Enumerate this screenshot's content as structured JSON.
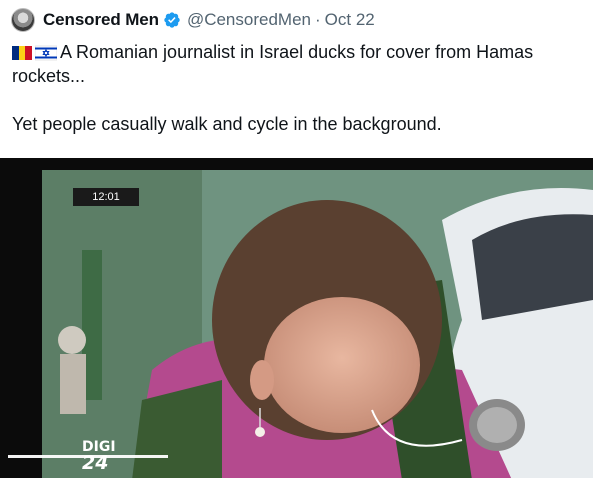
{
  "author": {
    "display_name": "Censored Men",
    "handle": "@CensoredMen",
    "separator": "·",
    "date": "Oct 22",
    "verified": true,
    "avatar_icon": "avatar-image"
  },
  "tweet": {
    "line1": "A Romanian journalist in Israel ducks for cover from Hamas rockets...",
    "line2": "Yet people casually walk and cycle in the background.",
    "flags": [
      "romania-flag-icon",
      "israel-flag-icon"
    ]
  },
  "video": {
    "timestamp": "12:01",
    "channel_logo_top": "DIGI",
    "channel_logo_bottom": "24"
  },
  "colors": {
    "verified_blue": "#1d9bf0",
    "muted_text": "#536471",
    "text": "#0f1419"
  }
}
